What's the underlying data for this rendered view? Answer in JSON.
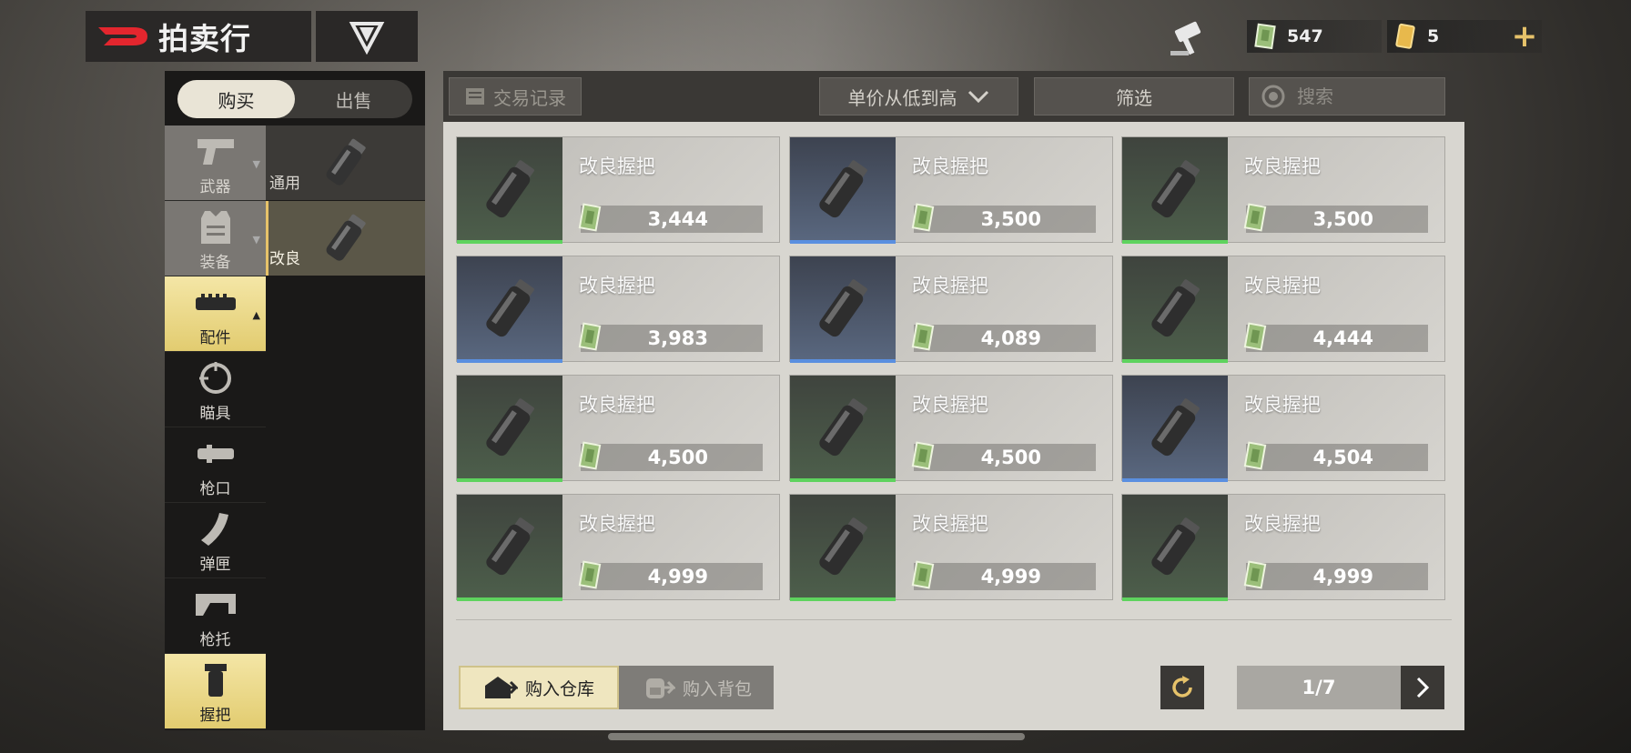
{
  "header": {
    "title": "拍卖行",
    "v_symbol": "V"
  },
  "currency": {
    "cash": "547",
    "coin": "5",
    "plus": "+"
  },
  "tabs": [
    {
      "label": "购买",
      "active": true
    },
    {
      "label": "出售",
      "active": false
    }
  ],
  "categories": [
    {
      "label": "武器",
      "icon": "pistol-icon"
    },
    {
      "label": "装备",
      "icon": "vest-icon"
    },
    {
      "label": "配件",
      "icon": "rail-icon",
      "active": true
    },
    {
      "label": "瞄具",
      "icon": "scope-icon"
    },
    {
      "label": "枪口",
      "icon": "muzzle-icon"
    },
    {
      "label": "弹匣",
      "icon": "magazine-icon"
    },
    {
      "label": "枪托",
      "icon": "stock-icon"
    },
    {
      "label": "握把",
      "icon": "grip-icon"
    }
  ],
  "subcategories": [
    {
      "label": "通用",
      "icon": "grip-icon"
    },
    {
      "label": "改良",
      "icon": "grip-icon",
      "active": true
    }
  ],
  "toolbar": {
    "history": "交易记录",
    "sort": "单价从低到高",
    "filter": "筛选",
    "search_placeholder": "搜索"
  },
  "listings": [
    {
      "name": "改良握把",
      "price": "3,444",
      "rarity": "green"
    },
    {
      "name": "改良握把",
      "price": "3,500",
      "rarity": "blue"
    },
    {
      "name": "改良握把",
      "price": "3,500",
      "rarity": "green"
    },
    {
      "name": "改良握把",
      "price": "3,983",
      "rarity": "blue"
    },
    {
      "name": "改良握把",
      "price": "4,089",
      "rarity": "blue"
    },
    {
      "name": "改良握把",
      "price": "4,444",
      "rarity": "green"
    },
    {
      "name": "改良握把",
      "price": "4,500",
      "rarity": "green"
    },
    {
      "name": "改良握把",
      "price": "4,500",
      "rarity": "green"
    },
    {
      "name": "改良握把",
      "price": "4,504",
      "rarity": "blue"
    },
    {
      "name": "改良握把",
      "price": "4,999",
      "rarity": "green"
    },
    {
      "name": "改良握把",
      "price": "4,999",
      "rarity": "green"
    },
    {
      "name": "改良握把",
      "price": "4,999",
      "rarity": "green"
    }
  ],
  "bottom": {
    "buy_warehouse": "购入仓库",
    "buy_backpack": "购入背包",
    "page": "1/7"
  },
  "colors": {
    "accent_gold": "#e6c26a",
    "rarity_green": "#5ed35e",
    "rarity_blue": "#5a8fe0"
  }
}
